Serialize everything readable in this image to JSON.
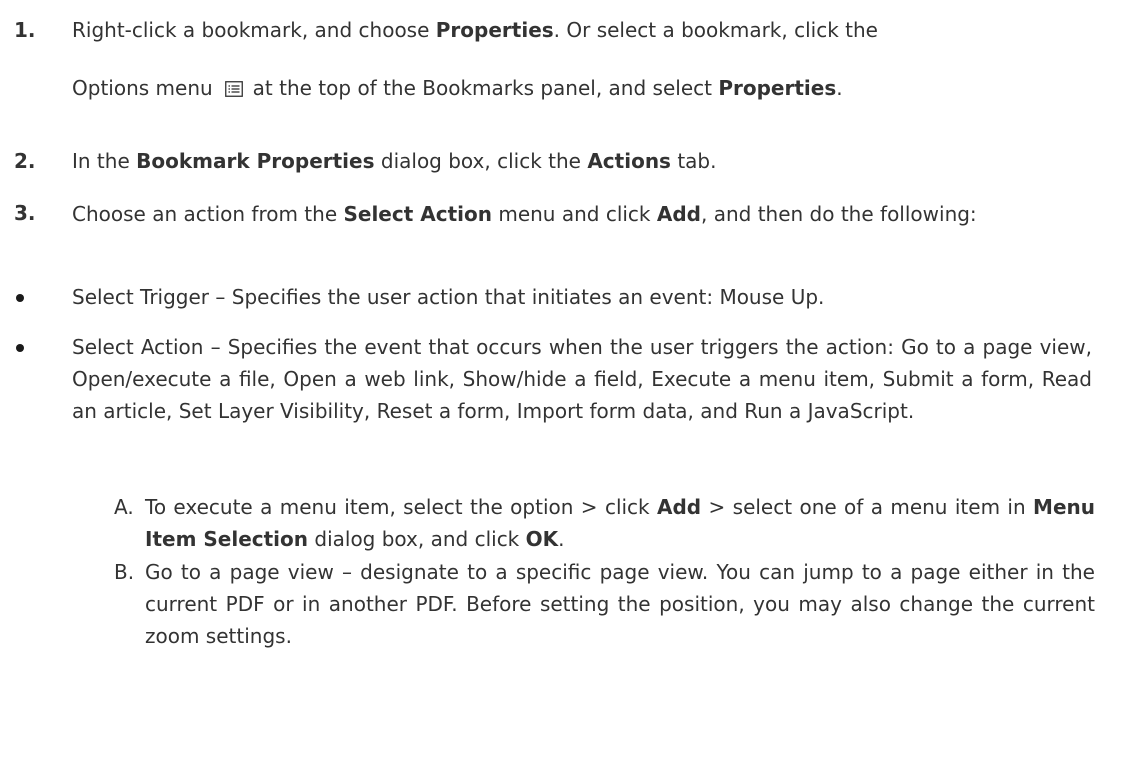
{
  "steps": [
    {
      "number": "1.",
      "part1": "Right-click a bookmark, and choose ",
      "bold1": "Properties",
      "part2": ". Or select a bookmark, click the",
      "part3": "Options menu",
      "part4": "at the top of the Bookmarks panel, and select ",
      "bold2": "Properties",
      "part5": "."
    },
    {
      "number": "2.",
      "part1": "In the ",
      "bold1": "Bookmark Properties",
      "part2": " dialog box, click the ",
      "bold2": "Actions",
      "part3": " tab."
    },
    {
      "number": "3.",
      "part1": "Choose an action from the ",
      "bold1": "Select Action",
      "part2": " menu and click ",
      "bold2": "Add",
      "part3": ", and then do the following:"
    }
  ],
  "bullets": [
    "Select Trigger – Specifies the user action that initiates an event: Mouse Up.",
    "Select Action – Specifies the event that occurs when the user triggers the action: Go to a page view, Open/execute a file, Open a web link, Show/hide a field, Execute a menu item, Submit a form, Read an article, Set Layer Visibility, Reset a form, Import form data, and Run a JavaScript."
  ],
  "substeps": [
    {
      "letter": "A.",
      "part1": "To execute a menu item, select the option > click ",
      "bold1": "Add",
      "part2": " > select one of a menu item in ",
      "bold2": "Menu Item Selection",
      "part3": " dialog box, and click ",
      "bold3": "OK",
      "part4": "."
    },
    {
      "letter": "B.",
      "text": "Go to a page view – designate to a specific page view. You can jump to a page either in the current PDF or in another PDF. Before setting the position, you may also change the current zoom settings."
    }
  ],
  "icon": "options-menu-icon"
}
